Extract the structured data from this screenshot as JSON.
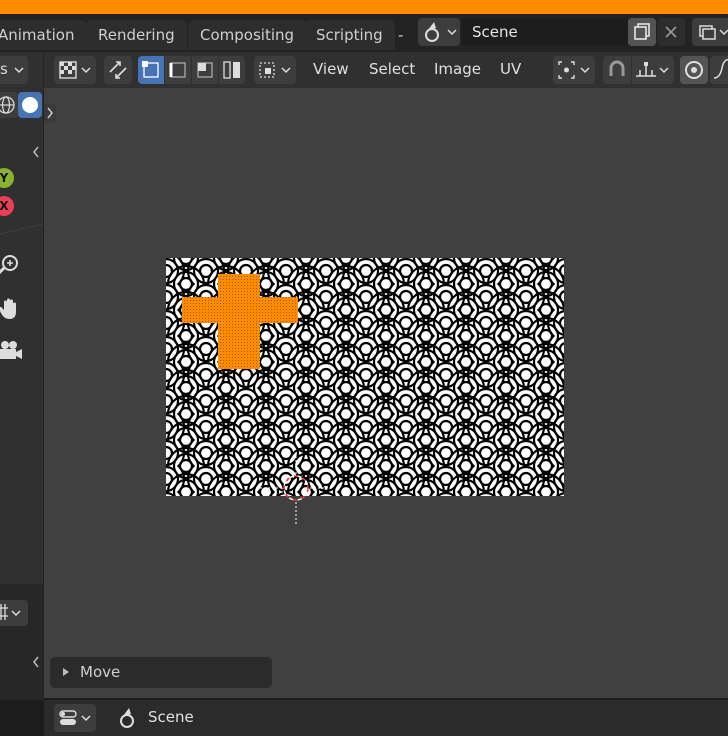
{
  "topbar": {
    "tabs": [
      {
        "label": "Animation"
      },
      {
        "label": "Rendering"
      },
      {
        "label": "Compositing"
      },
      {
        "label": "Scripting"
      },
      {
        "label": "-"
      }
    ],
    "scene_value": "Scene"
  },
  "left_panel": {
    "mode_fragment": "s",
    "axis_y": "Y",
    "axis_x": "X"
  },
  "uv_header": {
    "menus": [
      {
        "label": "View"
      },
      {
        "label": "Select"
      },
      {
        "label": "Image"
      },
      {
        "label": "UV"
      }
    ]
  },
  "operator_panel": {
    "title": "Move"
  },
  "status": {
    "scene_label": "Scene"
  },
  "colors": {
    "accent_orange": "#ff8c00",
    "active_blue": "#4772b3",
    "axis_y": "#8ab22e",
    "axis_x": "#ea3f55",
    "viewport_bg": "#404040"
  }
}
